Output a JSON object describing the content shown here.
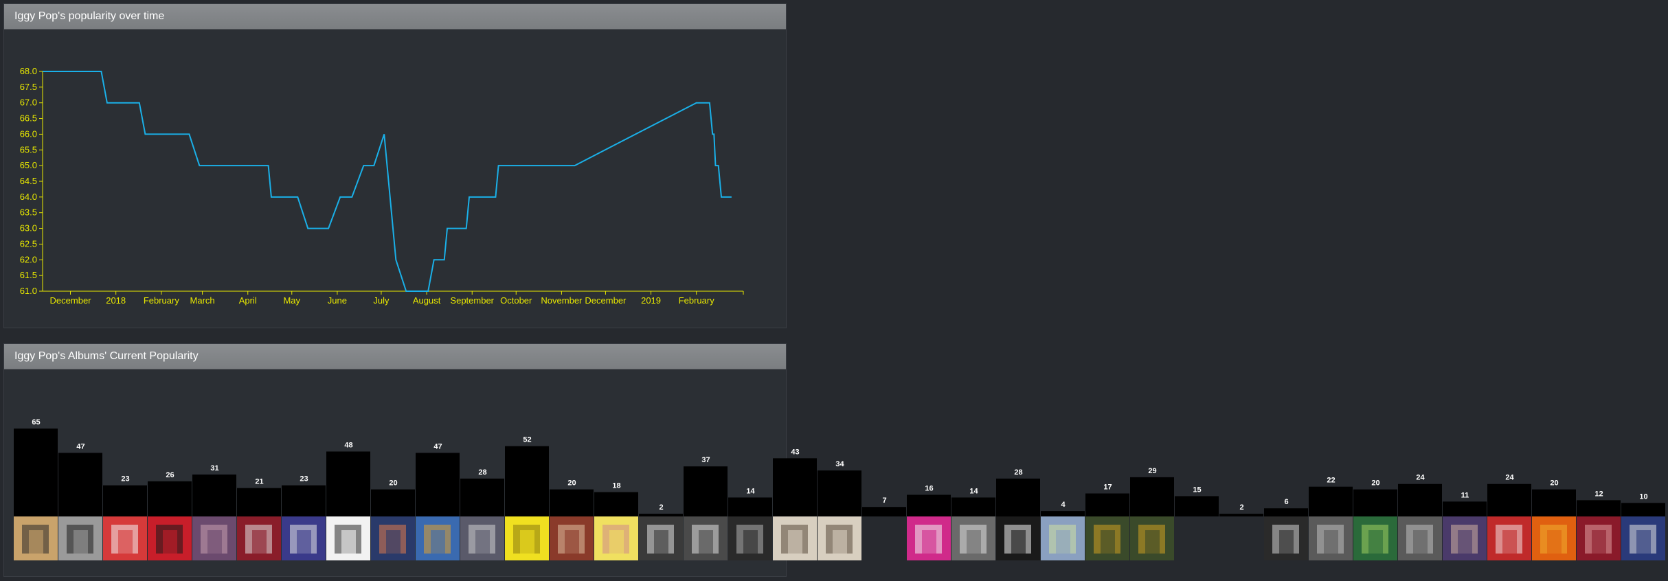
{
  "panels": {
    "line_title": "Iggy Pop's popularity over time",
    "bars_title": "Iggy Pop's Albums' Current Popularity"
  },
  "colors": {
    "background": "#26292e",
    "panel": "#2b2f34",
    "header": "#7f8285",
    "axis": "#e8e800",
    "line": "#1ab0e8",
    "bar": "#000000",
    "bar_label": "#ffffff"
  },
  "chart_data": [
    {
      "type": "line",
      "title": "Iggy Pop's popularity over time",
      "xlabel": "",
      "ylabel": "",
      "x_tick_labels": [
        "December",
        "2018",
        "February",
        "March",
        "April",
        "May",
        "June",
        "July",
        "August",
        "September",
        "October",
        "November",
        "December",
        "2019",
        "February"
      ],
      "x_tick_dates": [
        "2017-12-01",
        "2018-01-01",
        "2018-02-01",
        "2018-03-01",
        "2018-04-01",
        "2018-05-01",
        "2018-06-01",
        "2018-07-01",
        "2018-08-01",
        "2018-09-01",
        "2018-10-01",
        "2018-11-01",
        "2018-12-01",
        "2019-01-01",
        "2019-02-01"
      ],
      "xlim": [
        "2017-11-12",
        "2019-03-05"
      ],
      "ylim": [
        61.0,
        68.0
      ],
      "y_ticks": [
        "61.0",
        "61.5",
        "62.0",
        "62.5",
        "63.0",
        "63.5",
        "64.0",
        "64.5",
        "65.0",
        "65.5",
        "66.0",
        "66.5",
        "67.0",
        "67.5",
        "68.0"
      ],
      "grid": false,
      "series": [
        {
          "points": [
            [
              "2017-11-12",
              68
            ],
            [
              "2017-12-22",
              68
            ],
            [
              "2017-12-26",
              67
            ],
            [
              "2018-01-17",
              67
            ],
            [
              "2018-01-21",
              66
            ],
            [
              "2018-02-20",
              66
            ],
            [
              "2018-02-27",
              65
            ],
            [
              "2018-04-15",
              65
            ],
            [
              "2018-04-17",
              64
            ],
            [
              "2018-05-05",
              64
            ],
            [
              "2018-05-12",
              63
            ],
            [
              "2018-05-26",
              63
            ],
            [
              "2018-06-03",
              64
            ],
            [
              "2018-06-11",
              64
            ],
            [
              "2018-06-19",
              65
            ],
            [
              "2018-06-26",
              65
            ],
            [
              "2018-07-03",
              66
            ],
            [
              "2018-07-11",
              62
            ],
            [
              "2018-07-18",
              61
            ],
            [
              "2018-08-02",
              61
            ],
            [
              "2018-08-06",
              62
            ],
            [
              "2018-08-13",
              62
            ],
            [
              "2018-08-15",
              63
            ],
            [
              "2018-08-28",
              63
            ],
            [
              "2018-08-30",
              64
            ],
            [
              "2018-09-17",
              64
            ],
            [
              "2018-09-19",
              65
            ],
            [
              "2018-11-10",
              65
            ],
            [
              "2019-02-01",
              67
            ],
            [
              "2019-02-10",
              67
            ],
            [
              "2019-02-12",
              66
            ],
            [
              "2019-02-13",
              66
            ],
            [
              "2019-02-14",
              65
            ],
            [
              "2019-02-16",
              65
            ],
            [
              "2019-02-18",
              64
            ],
            [
              "2019-02-25",
              64
            ]
          ]
        }
      ]
    },
    {
      "type": "bar",
      "title": "Iggy Pop's Albums' Current Popularity",
      "xlabel": "",
      "ylabel": "",
      "ylim": [
        0,
        65
      ],
      "grid": false,
      "values": [
        65,
        47,
        23,
        26,
        31,
        21,
        23,
        48,
        20,
        47,
        28,
        52,
        20,
        18,
        2,
        37,
        14,
        43,
        34,
        7,
        16,
        14,
        28,
        4,
        17,
        29,
        15,
        2,
        6,
        22,
        20,
        24,
        11,
        24,
        20,
        12,
        10
      ],
      "covers": [
        [
          "#c9a36b",
          "#2a2a2a"
        ],
        [
          "#9a9a9a",
          "#1e1e1e"
        ],
        [
          "#d63a3a",
          "#f2f2f2"
        ],
        [
          "#c81e2a",
          "#1a1a1a"
        ],
        [
          "#6b4a6e",
          "#c8a0b0"
        ],
        [
          "#8a1d2a",
          "#e0e0e0"
        ],
        [
          "#3a3a8a",
          "#e6e6e6"
        ],
        [
          "#f2f2f2",
          "#2a2a2a"
        ],
        [
          "#2a3a6a",
          "#e07a4a"
        ],
        [
          "#3a6ab0",
          "#e0a030"
        ],
        [
          "#5a5a6a",
          "#d0d0d0"
        ],
        [
          "#f0e020",
          "#8a7a10"
        ],
        [
          "#8a3a2a",
          "#e0c0a0"
        ],
        [
          "#f0e060",
          "#d08a8a"
        ],
        [
          "#3a3a3a",
          "#e0e0e0"
        ],
        [
          "#4a4a4a",
          "#e0e0e0"
        ],
        [
          "#2a2a2a",
          "#b0b0b0"
        ],
        [
          "#d8cfc0",
          "#5a4a3a"
        ],
        [
          "#d8cfc0",
          "#5a4a3a"
        ],
        null,
        [
          "#d02a8a",
          "#f0f0f0"
        ],
        [
          "#6a6a6a",
          "#e0e0e0"
        ],
        [
          "#1a1a1a",
          "#f0f0f0"
        ],
        [
          "#8aa0c0",
          "#d0e0a0"
        ],
        [
          "#3a4a2a",
          "#d0a020"
        ],
        [
          "#3a4a2a",
          "#d0a020"
        ],
        null,
        null,
        [
          "#2a2a2a",
          "#d0d0d0"
        ],
        [
          "#5a5a5a",
          "#c0c0c0"
        ],
        [
          "#2a6a3a",
          "#a0d060"
        ],
        [
          "#5a5a5a",
          "#c0c0c0"
        ],
        [
          "#4a3a6a",
          "#d0b0a0"
        ],
        [
          "#c02a2a",
          "#f0e0e0"
        ],
        [
          "#e06010",
          "#f0b030"
        ],
        [
          "#8a1a2a",
          "#e0a0a0"
        ],
        [
          "#2a3a7a",
          "#e0e0e0"
        ]
      ]
    }
  ]
}
